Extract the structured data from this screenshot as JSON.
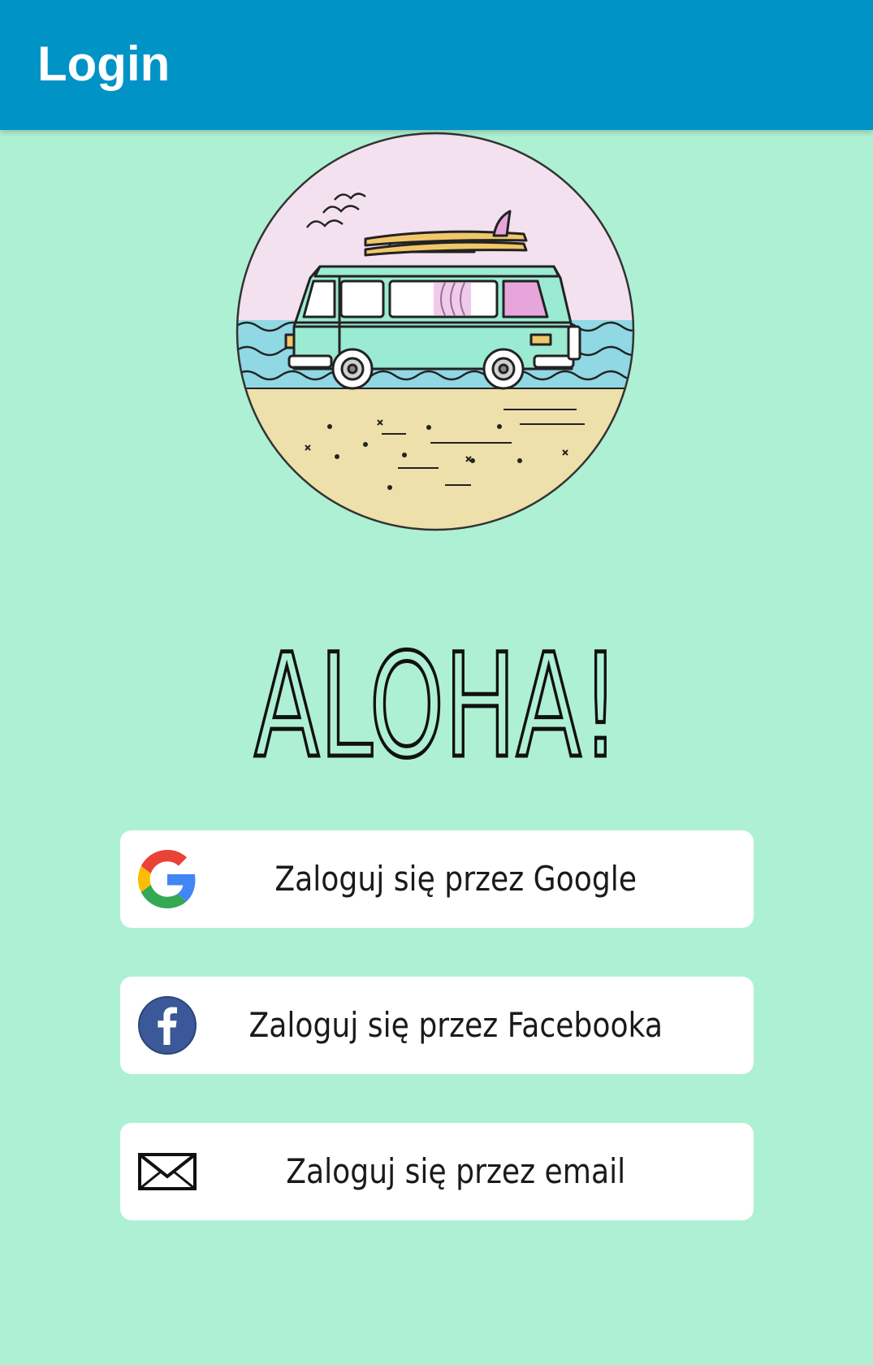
{
  "app_bar": {
    "title": "Login",
    "color": "#0093c6"
  },
  "screen": {
    "background": "#aef0d3"
  },
  "hero": {
    "illustration": "surf-van-beach-illustration"
  },
  "greeting": {
    "text": "ALOHA!"
  },
  "buttons": [
    {
      "label": "Zaloguj się przez Google",
      "icon": "google-icon"
    },
    {
      "label": "Zaloguj się przez Facebooka",
      "icon": "facebook-icon"
    },
    {
      "label": "Zaloguj się przez email",
      "icon": "envelope-icon"
    }
  ]
}
